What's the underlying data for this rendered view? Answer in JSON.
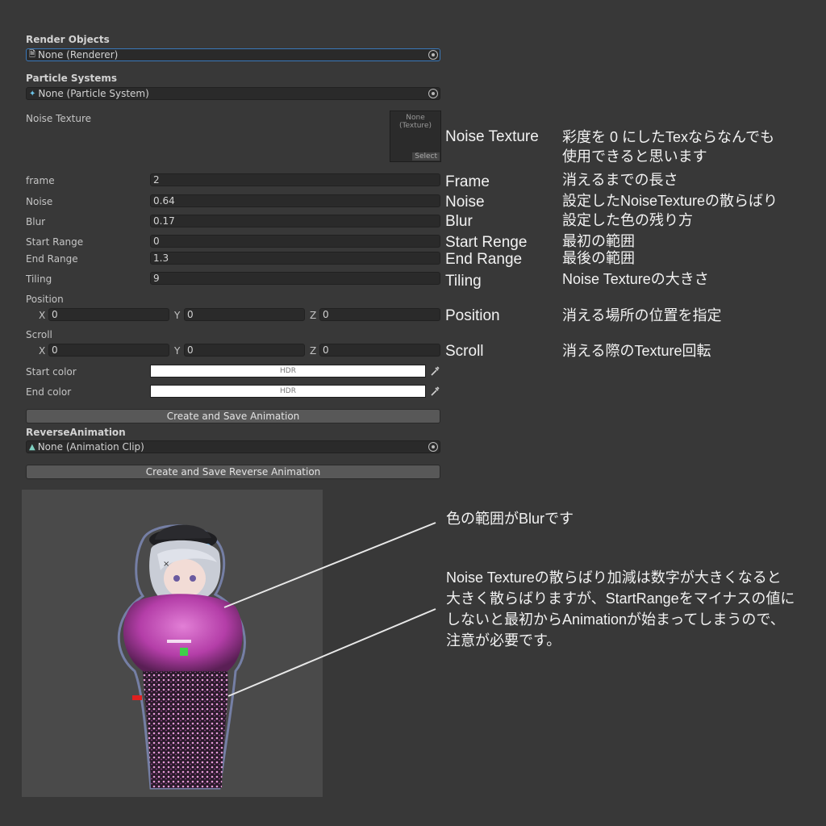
{
  "inspector": {
    "render_objects": {
      "header": "Render Objects",
      "value": "None (Renderer)"
    },
    "particle_systems": {
      "header": "Particle Systems",
      "value": "None (Particle System)"
    },
    "noise_texture": {
      "label": "Noise Texture",
      "thumb_line1": "None",
      "thumb_line2": "(Texture)",
      "select": "Select"
    },
    "frame": {
      "label": "frame",
      "value": "2"
    },
    "noise": {
      "label": "Noise",
      "value": "0.64"
    },
    "blur": {
      "label": "Blur",
      "value": "0.17"
    },
    "start_range": {
      "label": "Start Range",
      "value": "0"
    },
    "end_range": {
      "label": "End Range",
      "value": "1.3"
    },
    "tiling": {
      "label": "Tiling",
      "value": "9"
    },
    "position": {
      "label": "Position",
      "x_label": "X",
      "x": "0",
      "y_label": "Y",
      "y": "0",
      "z_label": "Z",
      "z": "0"
    },
    "scroll": {
      "label": "Scroll",
      "x_label": "X",
      "x": "0",
      "y_label": "Y",
      "y": "0",
      "z_label": "Z",
      "z": "0"
    },
    "start_color": {
      "label": "Start color",
      "value": "HDR",
      "color": "#ffffff"
    },
    "end_color": {
      "label": "End color",
      "value": "HDR",
      "color": "#ffffff"
    },
    "create_button": "Create and Save Animation",
    "reverse_animation": {
      "header": "ReverseAnimation",
      "value": "None (Animation Clip)"
    },
    "create_reverse_button": "Create and Save Reverse Animation"
  },
  "notes": [
    {
      "key": "Noise Texture",
      "desc": [
        "彩度を 0 にしたTexならなんでも",
        "使用できると思います"
      ]
    },
    {
      "key": "Frame",
      "desc": [
        "消えるまでの長さ"
      ]
    },
    {
      "key": "Noise",
      "desc": [
        "設定したNoiseTextureの散らばり"
      ]
    },
    {
      "key": "Blur",
      "desc": [
        "設定した色の残り方"
      ]
    },
    {
      "key": "Start Renge",
      "desc": [
        "最初の範囲"
      ]
    },
    {
      "key": "End Range",
      "desc": [
        "最後の範囲"
      ]
    },
    {
      "key": "Tiling",
      "desc": [
        "Noise Textureの大きさ"
      ]
    },
    {
      "key": "Position",
      "desc": [
        "消える場所の位置を指定"
      ]
    },
    {
      "key": "Scroll",
      "desc": [
        "消える際のTexture回転"
      ]
    }
  ],
  "annotations": {
    "blur": "色の範囲がBlurです",
    "noise": [
      "Noise Textureの散らばり加減は数字が大きくなると",
      "大きく散らばりますが、StartRangeをマイナスの値に",
      "しないと最初からAnimationが始まってしまうので、",
      "注意が必要です。"
    ]
  },
  "colors": {
    "background": "#383838",
    "field": "#2a2a2a",
    "button": "#585858",
    "focus_border": "#3a79bb",
    "preview_bg": "#4a4a4a",
    "dissolve": "#d65fc8"
  }
}
